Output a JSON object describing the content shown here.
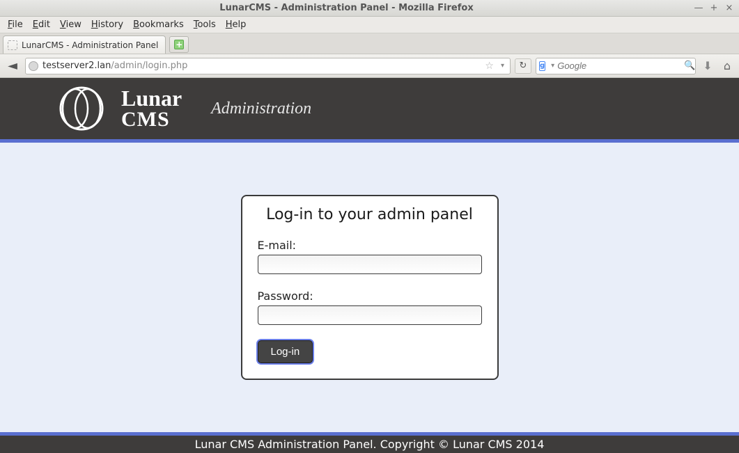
{
  "window": {
    "title": "LunarCMS - Administration Panel - Mozilla Firefox"
  },
  "menubar": {
    "file": "File",
    "edit": "Edit",
    "view": "View",
    "history": "History",
    "bookmarks": "Bookmarks",
    "tools": "Tools",
    "help": "Help"
  },
  "tab": {
    "title": "LunarCMS - Administration Panel"
  },
  "url": {
    "host": "testserver2.lan",
    "path": "/admin/login.php"
  },
  "search": {
    "placeholder": "Google"
  },
  "header": {
    "brand_line1": "Lunar",
    "brand_line2": "CMS",
    "section": "Administration"
  },
  "login": {
    "heading": "Log-in to your admin panel",
    "email_label": "E-mail:",
    "password_label": "Password:",
    "button": "Log-in",
    "email_value": "",
    "password_value": ""
  },
  "footer": {
    "text": "Lunar CMS Administration Panel. Copyright © Lunar CMS 2014"
  }
}
